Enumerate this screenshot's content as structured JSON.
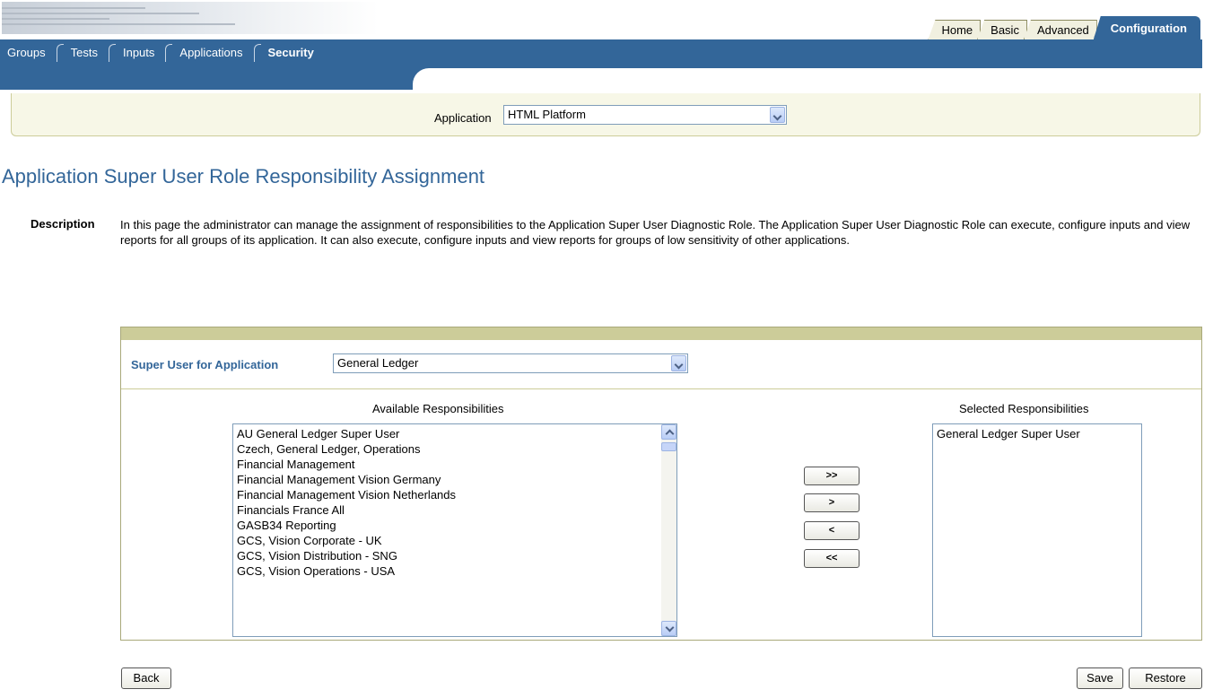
{
  "global_tabs": [
    {
      "label": "Home",
      "active": false
    },
    {
      "label": "Basic",
      "active": false
    },
    {
      "label": "Advanced",
      "active": false
    },
    {
      "label": "Configuration",
      "active": true
    }
  ],
  "sub_tabs": [
    {
      "label": "Groups",
      "active": false
    },
    {
      "label": "Tests",
      "active": false
    },
    {
      "label": "Inputs",
      "active": false
    },
    {
      "label": "Applications",
      "active": false
    },
    {
      "label": "Security",
      "active": true
    }
  ],
  "application_bar": {
    "label": "Application",
    "selected": "HTML Platform"
  },
  "page": {
    "title": "Application Super User Role Responsibility Assignment",
    "description_label": "Description",
    "description": "In this page the administrator can manage the assignment of responsibilities to the Application Super User Diagnostic Role. The Application Super User Diagnostic Role can execute, configure inputs and view reports for all groups of its application. It can also execute, configure inputs and view reports for groups of low sensitivity of other applications."
  },
  "shuttle": {
    "super_user_label": "Super User for Application",
    "super_user_selected": "General Ledger",
    "available_title": "Available Responsibilities",
    "selected_title": "Selected Responsibilities",
    "available": [
      "AU General Ledger Super User",
      "Czech, General Ledger, Operations",
      "Financial Management",
      "Financial Management Vision Germany",
      "Financial Management Vision Netherlands",
      "Financials France All",
      "GASB34 Reporting",
      "GCS, Vision Corporate - UK",
      "GCS, Vision Distribution - SNG",
      "GCS, Vision Operations - USA"
    ],
    "selected": [
      "General Ledger Super User"
    ],
    "move_all_label": ">>",
    "move_label": ">",
    "remove_label": "<",
    "remove_all_label": "<<"
  },
  "buttons": {
    "back": "Back",
    "save": "Save",
    "restore": "Restore"
  },
  "colors": {
    "brand_blue": "#336699",
    "tan": "#cccc99",
    "bar_bg": "#f7f7e7"
  }
}
